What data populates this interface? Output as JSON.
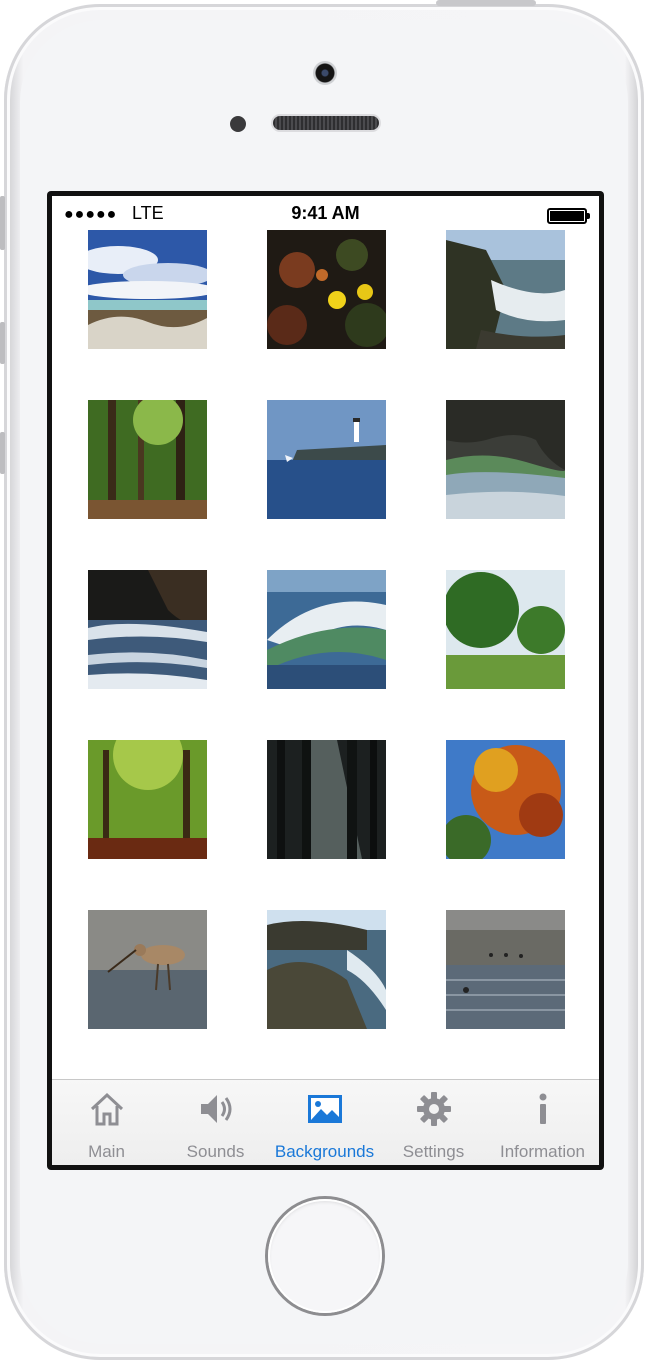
{
  "status_bar": {
    "signal_dots": "●●●●●",
    "carrier": "LTE",
    "time": "9:41 AM"
  },
  "backgrounds": [
    {
      "scene": "sky-clouds-beach"
    },
    {
      "scene": "autumn-leaves-yellow-flowers"
    },
    {
      "scene": "rocky-coast-waves"
    },
    {
      "scene": "forest-path"
    },
    {
      "scene": "lighthouse-sea"
    },
    {
      "scene": "sea-cave-wave"
    },
    {
      "scene": "cave-surf"
    },
    {
      "scene": "breaking-wave"
    },
    {
      "scene": "green-trees-meadow"
    },
    {
      "scene": "green-forest-leaf-path"
    },
    {
      "scene": "dark-forest-sunbeams"
    },
    {
      "scene": "autumn-tree-blue-sky"
    },
    {
      "scene": "shorebird-water"
    },
    {
      "scene": "coastal-rocks"
    },
    {
      "scene": "beach-birds"
    }
  ],
  "tab_bar": {
    "tabs": [
      {
        "label": "Main",
        "icon": "house-icon"
      },
      {
        "label": "Sounds",
        "icon": "speaker-icon"
      },
      {
        "label": "Backgrounds",
        "icon": "picture-icon",
        "active": true
      },
      {
        "label": "Settings",
        "icon": "gear-icon"
      },
      {
        "label": "Information",
        "icon": "info-icon"
      }
    ],
    "active_color": "#1a78d8",
    "inactive_color": "#8e8e93"
  }
}
